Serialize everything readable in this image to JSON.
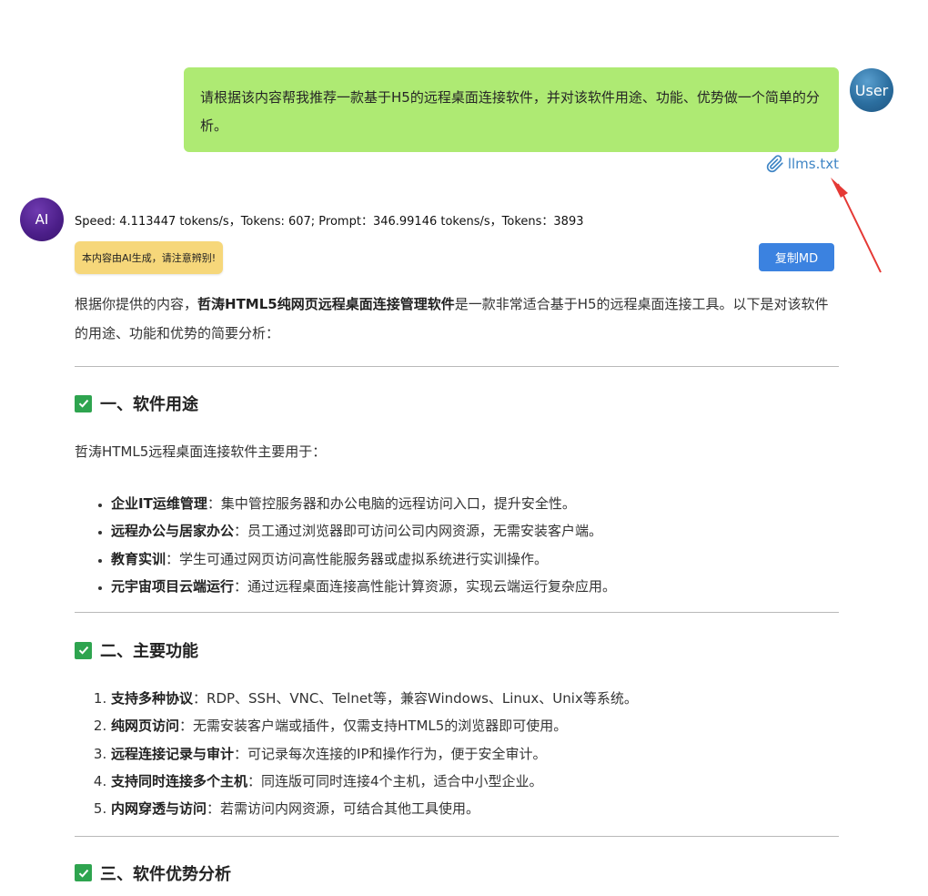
{
  "user_message": {
    "text": "请根据该内容帮我推荐一款基于H5的远程桌面连接软件，并对该软件用途、功能、优势做一个简单的分析。",
    "avatar_label": "User",
    "attachment_name": "llms.txt"
  },
  "ai_message": {
    "avatar_label": "AI",
    "speed_text": "Speed: 4.113447 tokens/s，Tokens: 607; Prompt：346.99146 tokens/s，Tokens：3893",
    "ai_notice": "本内容由AI生成，请注意辨别!",
    "copy_button": "复制MD",
    "intro": {
      "before": "根据你提供的内容，",
      "bold": "哲涛HTML5纯网页远程桌面连接管理软件",
      "after": "是一款非常适合基于H5的远程桌面连接工具。以下是对该软件的用途、功能和优势的简要分析："
    },
    "sections": [
      {
        "title": "一、软件用途",
        "lead": "哲涛HTML5远程桌面连接软件主要用于：",
        "items": [
          {
            "bold": "企业IT运维管理",
            "text": "：集中管控服务器和办公电脑的远程访问入口，提升安全性。"
          },
          {
            "bold": "远程办公与居家办公",
            "text": "：员工通过浏览器即可访问公司内网资源，无需安装客户端。"
          },
          {
            "bold": "教育实训",
            "text": "：学生可通过网页访问高性能服务器或虚拟系统进行实训操作。"
          },
          {
            "bold": "元宇宙项目云端运行",
            "text": "：通过远程桌面连接高性能计算资源，实现云端运行复杂应用。"
          }
        ]
      },
      {
        "title": "二、主要功能",
        "items": [
          {
            "bold": "支持多种协议",
            "text": "：RDP、SSH、VNC、Telnet等，兼容Windows、Linux、Unix等系统。"
          },
          {
            "bold": "纯网页访问",
            "text": "：无需安装客户端或插件，仅需支持HTML5的浏览器即可使用。"
          },
          {
            "bold": "远程连接记录与审计",
            "text": "：可记录每次连接的IP和操作行为，便于安全审计。"
          },
          {
            "bold": "支持同时连接多个主机",
            "text": "：同连版可同时连接4个主机，适合中小型企业。"
          },
          {
            "bold": "内网穿透与访问",
            "text": "：若需访问内网资源，可结合其他工具使用。"
          }
        ]
      },
      {
        "title": "三、软件优势分析"
      }
    ]
  },
  "colors": {
    "user_bubble": "#aeea73",
    "user_avatar": "#2b6e9f",
    "ai_avatar": "#4b1e88",
    "ai_notice": "#f6d77a",
    "copy_button": "#3b82e0",
    "attachment_link": "#3f85c5",
    "arrow": "#e53935",
    "check": "#2ea44f"
  },
  "icons": {
    "attachment": "paperclip-icon",
    "section": "check-mark-icon"
  }
}
